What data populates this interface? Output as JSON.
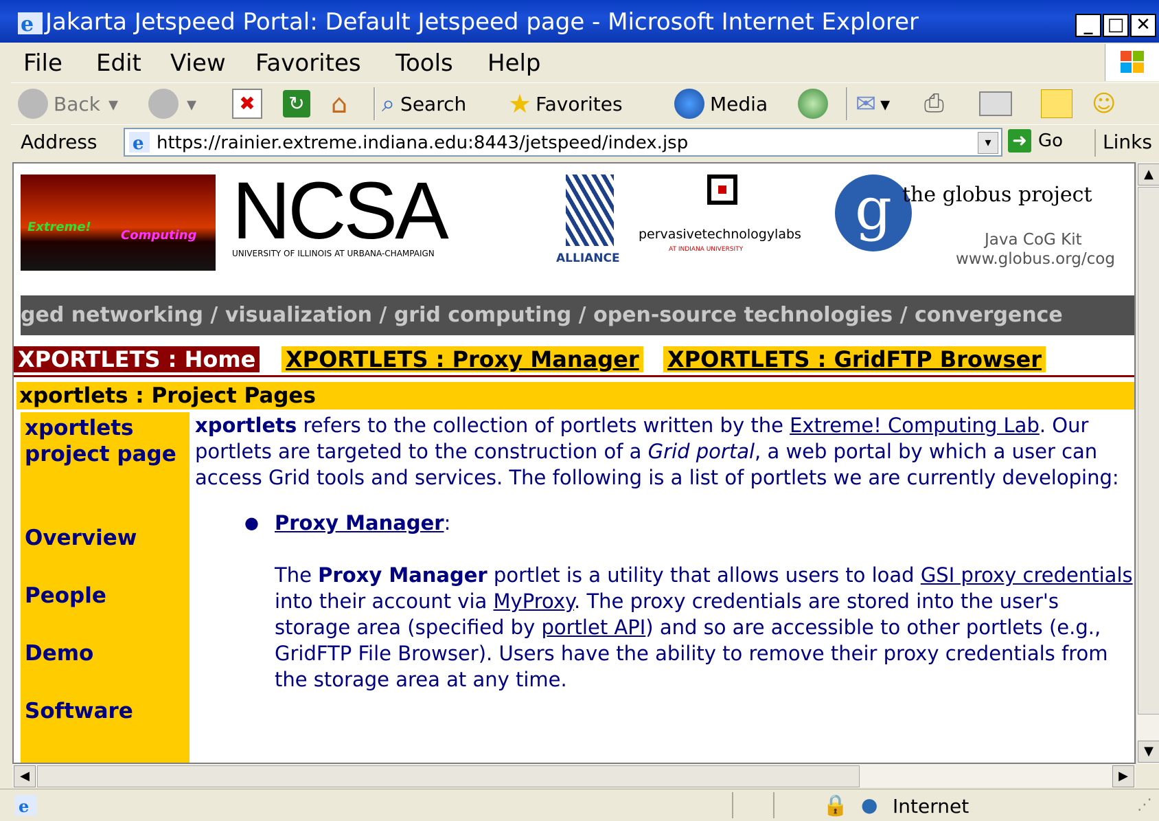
{
  "window": {
    "title": "Jakarta Jetspeed Portal: Default Jetspeed page - Microsoft Internet Explorer"
  },
  "menu": [
    "File",
    "Edit",
    "View",
    "Favorites",
    "Tools",
    "Help"
  ],
  "toolbar": {
    "back": "Back",
    "search": "Search",
    "favorites": "Favorites",
    "media": "Media"
  },
  "address": {
    "label": "Address",
    "url": "https://rainier.extreme.indiana.edu:8443/jetspeed/index.jsp",
    "go": "Go",
    "links": "Links"
  },
  "banner": {
    "extreme": "Extreme!",
    "computing": "Computing",
    "ncsa": "NCSA",
    "ncsa_sub": "UNIVERSITY OF ILLINOIS AT URBANA-CHAMPAIGN",
    "alliance": "ALLIANCE",
    "ptl": "pervasivetechnologylabs",
    "ptl_sub": "AT INDIANA UNIVERSITY",
    "globus": "the globus project",
    "cog1": "Java CoG Kit",
    "cog2": "www.globus.org/cog",
    "strip": "ged networking / visualization / grid computing / open-source technologies / convergence"
  },
  "tabs": [
    "XPORTLETS : Home",
    "XPORTLETS : Proxy Manager",
    "XPORTLETS : GridFTP Browser"
  ],
  "project_header": "xportlets : Project Pages",
  "nav": {
    "heading": "xportlets project page",
    "links": [
      "Overview",
      "People",
      "Demo",
      "Software"
    ]
  },
  "intro": {
    "bold": "xportlets",
    "t1": " refers to the collection of portlets written by the ",
    "link1": "Extreme! Computing Lab",
    "t2": ". Our portlets are targeted to the construction of a ",
    "ital": "Grid portal",
    "t3": ", a web portal by which a user can access Grid tools and services. The following is a list of portlets we are currently developing:"
  },
  "bullet": {
    "link": "Proxy Manager",
    "colon": ":"
  },
  "desc": {
    "t1": "The ",
    "bold": "Proxy Manager",
    "t2": " portlet is a utility that allows users to load ",
    "link1": "GSI proxy credentials",
    "t3": " into their account via ",
    "link2": "MyProxy",
    "t4": ". The proxy credentials are stored into the user's storage area (specified by ",
    "link3": "portlet API",
    "t5": ") and so are accessible to other portlets (e.g., GridFTP File Browser). Users have the ability to remove their proxy credentials from the storage area at any time."
  },
  "status": {
    "zone": "Internet"
  },
  "colors": {
    "titlebar": "#0a3cc0",
    "tab_active": "#8b0000",
    "tab": "#ffcc00",
    "link": "#000080"
  }
}
